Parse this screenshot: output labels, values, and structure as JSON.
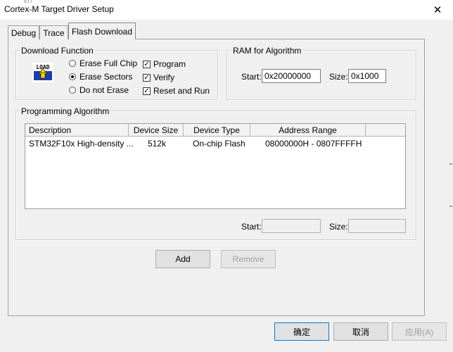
{
  "window": {
    "title": "Cortex-M Target Driver Setup",
    "top_stub": "ΕΠ"
  },
  "tabs": [
    {
      "label": "Debug"
    },
    {
      "label": "Trace"
    },
    {
      "label": "Flash Download"
    }
  ],
  "download_function": {
    "legend": "Download Function",
    "icon_text": "LOAD",
    "erase_options": [
      {
        "label": "Erase Full Chip",
        "selected": false
      },
      {
        "label": "Erase Sectors",
        "selected": true
      },
      {
        "label": "Do not Erase",
        "selected": false
      }
    ],
    "checks": [
      {
        "label": "Program",
        "checked": true
      },
      {
        "label": "Verify",
        "checked": true
      },
      {
        "label": "Reset and Run",
        "checked": true
      }
    ]
  },
  "ram": {
    "legend": "RAM for Algorithm",
    "start_label": "Start:",
    "start_value": "0x20000000",
    "size_label": "Size:",
    "size_value": "0x1000"
  },
  "programming": {
    "legend": "Programming Algorithm",
    "columns": [
      "Description",
      "Device Size",
      "Device Type",
      "Address Range"
    ],
    "rows": [
      {
        "description": "STM32F10x High-density ...",
        "size": "512k",
        "type": "On-chip Flash",
        "range": "08000000H - 0807FFFFH"
      }
    ],
    "start_label": "Start:",
    "start_value": "",
    "size_label": "Size:",
    "size_value": "",
    "add_label": "Add",
    "remove_label": "Remove"
  },
  "footer": {
    "ok_label": "确定",
    "cancel_label": "取消",
    "apply_label": "应用(A)"
  },
  "colors": {
    "accent": "#0078d7",
    "background": "#f0f0f0",
    "icon_blue": "#1f3fa8",
    "icon_yellow": "#f5d800"
  }
}
